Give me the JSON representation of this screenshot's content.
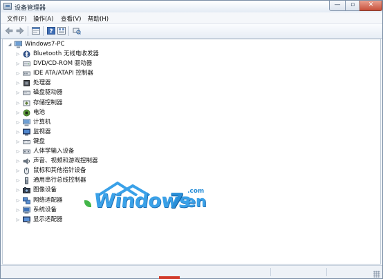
{
  "window": {
    "title": "设备管理器",
    "controls": {
      "minimize": "—",
      "maximize": "▫",
      "close": "✕"
    }
  },
  "menubar": {
    "items": [
      {
        "label": "文件(F)"
      },
      {
        "label": "操作(A)"
      },
      {
        "label": "查看(V)"
      },
      {
        "label": "帮助(H)"
      }
    ]
  },
  "toolbar": {
    "buttons": [
      "back-arrow-icon",
      "forward-arrow-icon",
      "properties-icon",
      "help-icon",
      "toggle-view-icon",
      "scan-hardware-icon"
    ]
  },
  "tree": {
    "root": "Windows7-PC",
    "items": [
      {
        "label": "Bluetooth 无线电收发器",
        "icon": "bluetooth-icon"
      },
      {
        "label": "DVD/CD-ROM 驱动器",
        "icon": "dvd-drive-icon"
      },
      {
        "label": "IDE ATA/ATAPI 控制器",
        "icon": "ide-controller-icon"
      },
      {
        "label": "处理器",
        "icon": "processor-icon"
      },
      {
        "label": "磁盘驱动器",
        "icon": "disk-drive-icon"
      },
      {
        "label": "存储控制器",
        "icon": "storage-controller-icon"
      },
      {
        "label": "电池",
        "icon": "battery-icon"
      },
      {
        "label": "计算机",
        "icon": "computer-icon"
      },
      {
        "label": "监视器",
        "icon": "monitor-icon"
      },
      {
        "label": "键盘",
        "icon": "keyboard-icon"
      },
      {
        "label": "人体学输入设备",
        "icon": "hid-icon"
      },
      {
        "label": "声音、视频和游戏控制器",
        "icon": "sound-icon"
      },
      {
        "label": "鼠标和其他指针设备",
        "icon": "mouse-icon"
      },
      {
        "label": "通用串行总线控制器",
        "icon": "usb-icon"
      },
      {
        "label": "图像设备",
        "icon": "imaging-device-icon"
      },
      {
        "label": "网络适配器",
        "icon": "network-adapter-icon"
      },
      {
        "label": "系统设备",
        "icon": "system-device-icon"
      },
      {
        "label": "显示适配器",
        "icon": "display-adapter-icon"
      }
    ]
  },
  "watermark": {
    "text": "Windows",
    "seven": "7",
    "suffix": "en",
    "domain": ".com"
  }
}
